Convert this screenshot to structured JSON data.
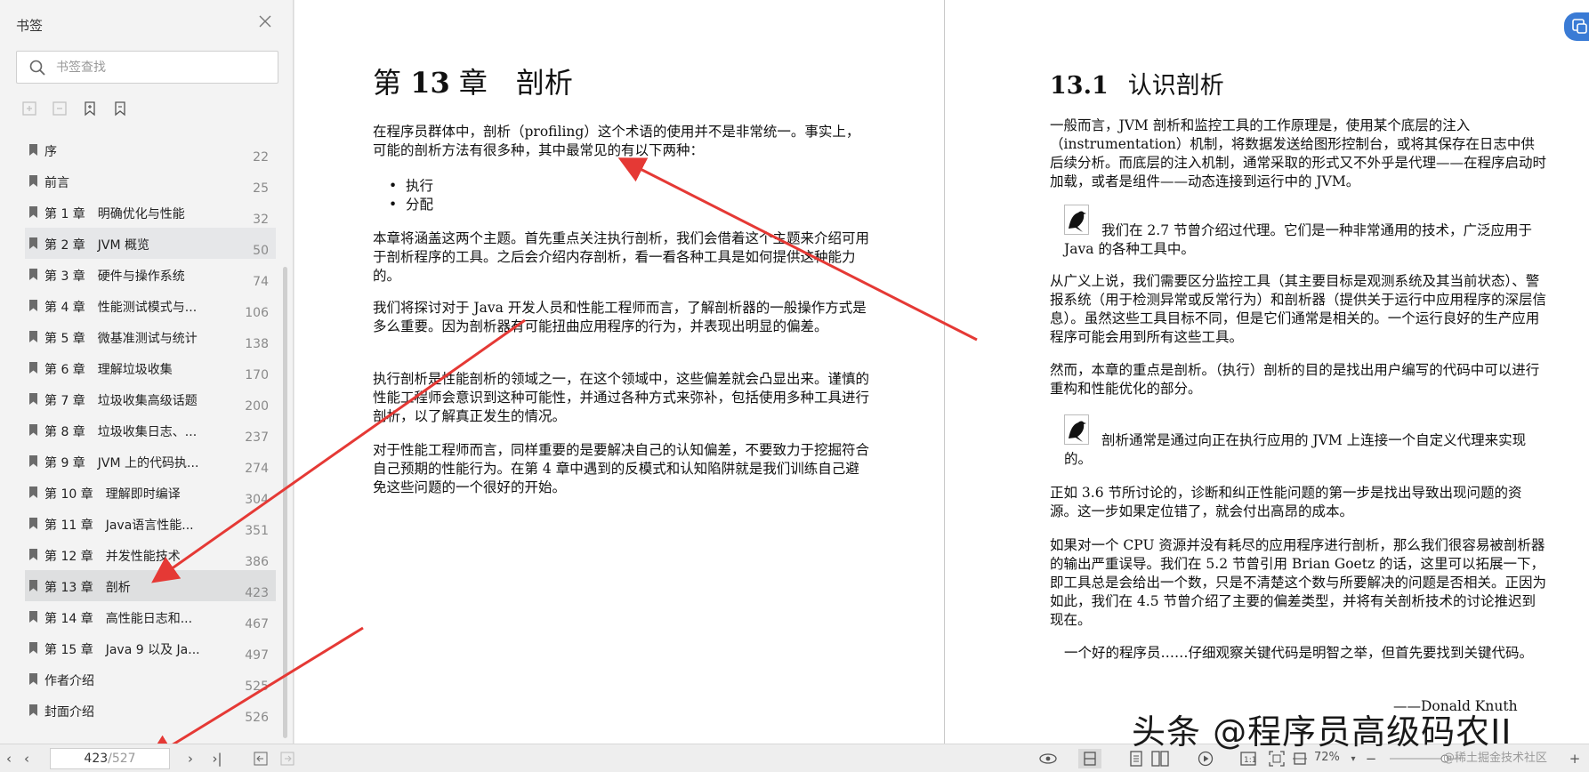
{
  "sidebar": {
    "title": "书签",
    "search_placeholder": "书签查找",
    "items": [
      {
        "label": "序",
        "page": "22"
      },
      {
        "label": "前言",
        "page": "25"
      },
      {
        "label": "第 1 章　明确优化与性能",
        "page": "32"
      },
      {
        "label": "第 2 章　JVM 概览",
        "page": "50"
      },
      {
        "label": "第 3 章　硬件与操作系统",
        "page": "74"
      },
      {
        "label": "第 4 章　性能测试模式与...",
        "page": "106"
      },
      {
        "label": "第 5 章　微基准测试与统计",
        "page": "138"
      },
      {
        "label": "第 6 章　理解垃圾收集",
        "page": "170"
      },
      {
        "label": "第 7 章　垃圾收集高级话题",
        "page": "200"
      },
      {
        "label": "第 8 章　垃圾收集日志、...",
        "page": "237"
      },
      {
        "label": "第 9 章　JVM 上的代码执...",
        "page": "274"
      },
      {
        "label": "第 10 章　理解即时编译",
        "page": "304"
      },
      {
        "label": "第 11 章　Java语言性能...",
        "page": "351"
      },
      {
        "label": "第 12 章　并发性能技术",
        "page": "386"
      },
      {
        "label": "第 13 章　剖析",
        "page": "423"
      },
      {
        "label": "第 14 章　高性能日志和...",
        "page": "467"
      },
      {
        "label": "第 15 章　Java 9 以及 Ja...",
        "page": "497"
      },
      {
        "label": "作者介绍",
        "page": "525"
      },
      {
        "label": "封面介绍",
        "page": "526"
      }
    ]
  },
  "left_page": {
    "chapter_prefix": "第",
    "chapter_num": "13",
    "chapter_suffix": "章　剖析",
    "p1": "在程序员群体中，剖析（profiling）这个术语的使用并不是非常统一。事实上，可能的剖析方法有很多种，其中最常见的有以下两种：",
    "bullets": [
      "执行",
      "分配"
    ],
    "p2": "本章将涵盖这两个主题。首先重点关注执行剖析，我们会借着这个主题来介绍可用于剖析程序的工具。之后会介绍内存剖析，看一看各种工具是如何提供这种能力的。",
    "p3": "我们将探讨对于 Java 开发人员和性能工程师而言，了解剖析器的一般操作方式是多么重要。因为剖析器有可能扭曲应用程序的行为，并表现出明显的偏差。",
    "p4": "执行剖析是性能剖析的领域之一，在这个领域中，这些偏差就会凸显出来。谨慎的性能工程师会意识到这种可能性，并通过各种方式来弥补，包括使用多种工具进行剖析，以了解真正发生的情况。",
    "p5": "对于性能工程师而言，同样重要的是要解决自己的认知偏差，不要致力于挖掘符合自己预期的性能行为。在第 4 章中遇到的反模式和认知陷阱就是我们训练自己避免这些问题的一个很好的开始。"
  },
  "right_page": {
    "section_num": "13.1",
    "section_title": "认识剖析",
    "p1": "一般而言，JVM 剖析和监控工具的工作原理是，使用某个底层的注入（instrumentation）机制，将数据发送给图形控制台，或将其保存在日志中供后续分析。而底层的注入机制，通常采取的形式又不外乎是代理——在程序启动时加载，或者是组件——动态连接到运行中的 JVM。",
    "note1": "我们在 2.7 节曾介绍过代理。它们是一种非常通用的技术，广泛应用于 Java 的各种工具中。",
    "p2": "从广义上说，我们需要区分监控工具（其主要目标是观测系统及其当前状态）、警报系统（用于检测异常或反常行为）和剖析器（提供关于运行中应用程序的深层信息）。虽然这些工具目标不同，但是它们通常是相关的。一个运行良好的生产应用程序可能会用到所有这些工具。",
    "p3": "然而，本章的重点是剖析。（执行）剖析的目的是找出用户编写的代码中可以进行重构和性能优化的部分。",
    "note2": "剖析通常是通过向正在执行应用的 JVM 上连接一个自定义代理来实现的。",
    "p4": "正如 3.6 节所讨论的，诊断和纠正性能问题的第一步是找出导致出现问题的资源。这一步如果定位错了，就会付出高昂的成本。",
    "p5": "如果对一个 CPU 资源并没有耗尽的应用程序进行剖析，那么我们很容易被剖析器的输出严重误导。我们在 5.2 节曾引用 Brian Goetz 的话，这里可以拓展一下，即工具总是会给出一个数，只是不清楚这个数与所要解决的问题是否相关。正因为如此，我们在 4.5 节曾介绍了主要的偏差类型，并将有关剖析技术的讨论推迟到现在。",
    "quote": "一个好的程序员……仔细观察关键代码是明智之举，但首先要找到关键代码。",
    "quote_author": "——Donald Knuth"
  },
  "bottombar": {
    "current_page": "423",
    "total_pages": "/527",
    "zoom": "72%"
  },
  "watermark": {
    "main": "头条 @程序员高级码农II",
    "sub": "@稀土掘金技术社区"
  },
  "colors": {
    "arrow": "#e53935",
    "accent": "#3a7bd5"
  }
}
